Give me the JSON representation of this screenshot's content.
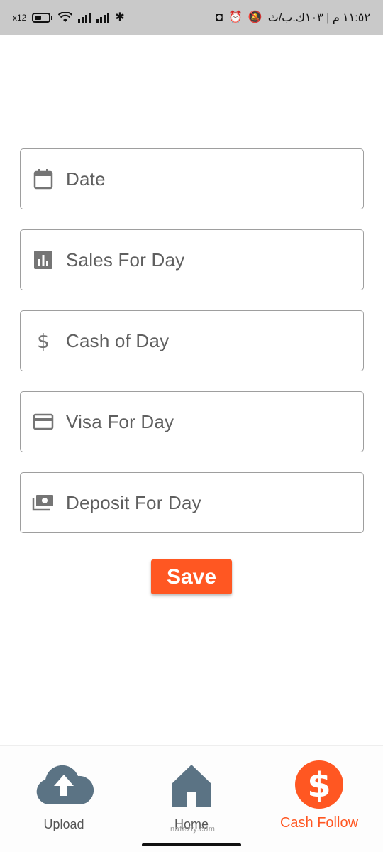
{
  "status_bar": {
    "left_text": "x12",
    "right_text": "١١:٥٢ م | ١٠٣ك.ب/ث"
  },
  "form": {
    "fields": [
      {
        "label": "Date",
        "icon": "calendar-icon"
      },
      {
        "label": "Sales For Day",
        "icon": "bar-chart-icon"
      },
      {
        "label": "Cash of Day",
        "icon": "dollar-icon"
      },
      {
        "label": "Visa For Day",
        "icon": "credit-card-icon"
      },
      {
        "label": "Deposit For Day",
        "icon": "money-icon"
      }
    ],
    "save_label": "Save"
  },
  "bottom_nav": {
    "items": [
      {
        "label": "Upload",
        "icon": "cloud-upload-icon"
      },
      {
        "label": "Home",
        "icon": "home-icon"
      },
      {
        "label": "Cash Follow",
        "icon": "dollar-circle-icon"
      }
    ]
  },
  "watermark": "nafezly.com",
  "colors": {
    "accent": "#ff5722",
    "nav_icon": "#5b7384",
    "field_border": "#9e9e9e",
    "status_bar": "#c9c9c9"
  }
}
